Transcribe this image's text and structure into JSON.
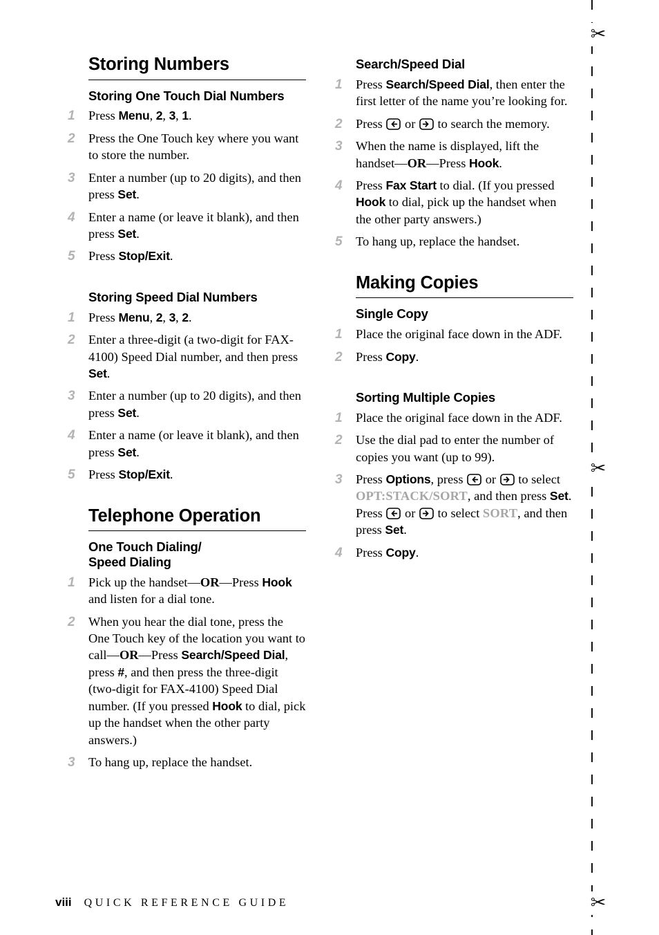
{
  "page": {
    "folio": "viii",
    "footer_title": "QUICK REFERENCE GUIDE"
  },
  "icons": {
    "scissors": "scissors-icon",
    "left_arrow_key": "left-arrow-key-icon",
    "right_arrow_key": "right-arrow-key-icon"
  },
  "colors": {
    "step_number": "#b3b3b3",
    "lcd_text": "#a6a6a6",
    "rule": "#000000",
    "text": "#000000"
  },
  "left_column": {
    "section1": {
      "title": "Storing Numbers",
      "sub1": {
        "title": "Storing One Touch Dial Numbers",
        "steps": [
          {
            "n": "1",
            "html": "Press <span class=\"b\">Menu</span>, <span class=\"b\">2</span>, <span class=\"b\">3</span>, <span class=\"b\">1</span>."
          },
          {
            "n": "2",
            "html": "Press the One Touch key where you want to store the number."
          },
          {
            "n": "3",
            "html": "Enter a number (up to 20 digits), and then press <span class=\"b\">Set</span>."
          },
          {
            "n": "4",
            "html": "Enter a name (or leave it blank), and then press <span class=\"b\">Set</span>."
          },
          {
            "n": "5",
            "html": "Press <span class=\"b\">Stop/Exit</span>."
          }
        ]
      },
      "sub2": {
        "title": "Storing Speed Dial Numbers",
        "steps": [
          {
            "n": "1",
            "html": "Press <span class=\"b\">Menu</span>, <span class=\"b\">2</span>, <span class=\"b\">3</span>, <span class=\"b\">2</span>."
          },
          {
            "n": "2",
            "html": "Enter a three-digit (a two-digit for FAX-4100) Speed Dial number, and then press <span class=\"b\">Set</span>."
          },
          {
            "n": "3",
            "html": "Enter a number (up to 20 digits), and then press <span class=\"b\">Set</span>."
          },
          {
            "n": "4",
            "html": "Enter a name (or leave it blank), and then press <span class=\"b\">Set</span>."
          },
          {
            "n": "5",
            "html": "Press <span class=\"b\">Stop/Exit</span>."
          }
        ]
      }
    },
    "section2": {
      "title": "Telephone Operation",
      "sub1": {
        "title": "One Touch Dialing/ Speed Dialing",
        "title_line1": "One Touch Dialing/",
        "title_line2": "Speed Dialing",
        "steps": [
          {
            "n": "1",
            "html": "Pick up the handset&#8212;<span class=\"bser\">OR</span>&#8212;Press <span class=\"b\">Hook</span> and listen for a dial tone."
          },
          {
            "n": "2",
            "html": "When you hear the dial tone, press the One Touch key of the location you want to call&#8212;<span class=\"bser\">OR</span>&#8212;Press <span class=\"b\">Search/Speed Dial</span>, press <span class=\"b\">#</span>, and then press the three-digit (two-digit for FAX-4100) Speed Dial number. (If you pressed <span class=\"b\">Hook</span> to dial, pick up the handset when the other party answers.)"
          },
          {
            "n": "3",
            "html": "To hang up, replace the handset."
          }
        ]
      }
    }
  },
  "right_column": {
    "section1": {
      "sub1": {
        "title": "Search/Speed Dial",
        "steps": [
          {
            "n": "1",
            "html": "Press <span class=\"b\">Search/Speed Dial</span>, then enter the first letter of the name you&#8217;re looking for."
          },
          {
            "n": "2",
            "html": "Press __LEFT__ or __RIGHT__ to search the memory."
          },
          {
            "n": "3",
            "html": "When the name is displayed, lift the handset&#8212;<span class=\"bser\">OR</span>&#8212;Press <span class=\"b\">Hook</span>."
          },
          {
            "n": "4",
            "html": "Press <span class=\"b\">Fax Start</span> to dial. (If you pressed <span class=\"b\">Hook</span> to dial, pick up the handset when the other party answers.)"
          },
          {
            "n": "5",
            "html": "To hang up, replace the handset."
          }
        ]
      }
    },
    "section2": {
      "title": "Making Copies",
      "sub1": {
        "title": "Single Copy",
        "steps": [
          {
            "n": "1",
            "html": "Place the original face down in the ADF."
          },
          {
            "n": "2",
            "html": "Press <span class=\"b\">Copy</span>."
          }
        ]
      },
      "sub2": {
        "title": "Sorting Multiple Copies",
        "steps": [
          {
            "n": "1",
            "html": "Place the original face down in the ADF."
          },
          {
            "n": "2",
            "html": "Use the dial pad to enter the number of copies you want (up to 99)."
          },
          {
            "n": "3",
            "html": "Press <span class=\"b\">Options</span>, press __LEFT__ or __RIGHT__ to select <span class=\"lcd\">OPT:STACK/SORT</span>, and then press <span class=\"b\">Set</span>.<br>Press __LEFT__ or __RIGHT__ to select <span class=\"lcd\">SORT</span>, and then press <span class=\"b\">Set</span>."
          },
          {
            "n": "4",
            "html": "Press <span class=\"b\">Copy</span>."
          }
        ]
      }
    }
  }
}
